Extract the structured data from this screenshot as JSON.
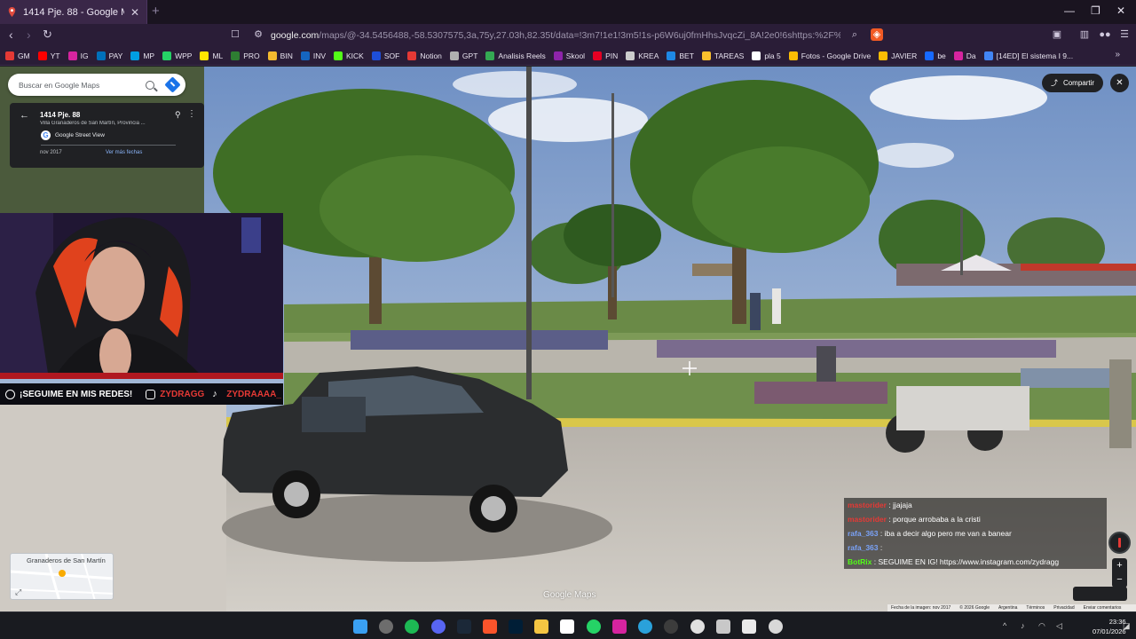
{
  "browser": {
    "tab_title": "1414 Pje. 88 - Google Maps",
    "url_host": "google.com",
    "url_path": "/maps/@-34.5456488,-58.5307575,3a,75y,27.03h,82.35t/data=!3m7!1e1!3m5!1s-p6W6uj0fmHhsJvqcZi_8A!2e0!6shttps:%2F%2Fstreetviewpixels...",
    "bookmarks": [
      {
        "label": "GM",
        "color": "#e53935"
      },
      {
        "label": "YT",
        "color": "#ff0000"
      },
      {
        "label": "IG",
        "color": "#d6249f"
      },
      {
        "label": "PAY",
        "color": "#0070ba"
      },
      {
        "label": "MP",
        "color": "#009ee3"
      },
      {
        "label": "WPP",
        "color": "#25d366"
      },
      {
        "label": "ML",
        "color": "#ffe600"
      },
      {
        "label": "PRO",
        "color": "#2e7d32"
      },
      {
        "label": "BIN",
        "color": "#f3ba2f"
      },
      {
        "label": "INV",
        "color": "#1565c0"
      },
      {
        "label": "KICK",
        "color": "#53fc18"
      },
      {
        "label": "SOF",
        "color": "#1e4ed8"
      },
      {
        "label": "Notion",
        "color": "#e53935"
      },
      {
        "label": "GPT",
        "color": "#b0b0b0"
      },
      {
        "label": "Analisis Reels",
        "color": "#34a853"
      },
      {
        "label": "Skool",
        "color": "#8e24aa"
      },
      {
        "label": "PIN",
        "color": "#e60023"
      },
      {
        "label": "KREA",
        "color": "#cccccc"
      },
      {
        "label": "BET",
        "color": "#1e88e5"
      },
      {
        "label": "TAREAS",
        "color": "#fbc02d"
      },
      {
        "label": "pla 5",
        "color": "#ffffff"
      },
      {
        "label": "Fotos - Google Drive",
        "color": "#fbbc04"
      },
      {
        "label": "JAVIER",
        "color": "#fbbc04"
      },
      {
        "label": "be",
        "color": "#1769ff"
      },
      {
        "label": "Da",
        "color": "#d6249f"
      },
      {
        "label": "[14ED] El sistema I 9...",
        "color": "#4285f4"
      }
    ],
    "bookmarks_more": "»"
  },
  "maps": {
    "search_placeholder": "Buscar en Google Maps",
    "place_title": "1414 Pje. 88",
    "place_subtitle": "Villa Granaderos de San Martín, Provincia ...",
    "source": "Google Street View",
    "capture_date": "nov 2017",
    "more_dates": "Ver más fechas",
    "share_label": "Compartir",
    "minimap_label": "Granaderos de San Martín",
    "watermark": "Google Maps",
    "footer": [
      "Fecha de la imagen: nov 2017",
      "© 2026 Google",
      "Argentina",
      "Términos",
      "Privacidad",
      "Enviar comentarios"
    ]
  },
  "stream": {
    "social_text": "¡SEGUIME EN MIS REDES!",
    "handle_ig": "ZYDRAGG",
    "handle_tiktok": "ZYDRAAAA_"
  },
  "chat": [
    {
      "user": "mastorider",
      "text": ": jjajaja",
      "color": "#e53935"
    },
    {
      "user": "mastorider",
      "text": ": porque arrobaba a la cristi",
      "color": "#e53935"
    },
    {
      "user": "rafa_363",
      "text": ": iba a decir algo pero me van a banear",
      "color": "#7aa2f7"
    },
    {
      "user": "rafa_363",
      "text": ":",
      "color": "#7aa2f7"
    },
    {
      "user": "BotRix",
      "text": ": SEGUIME EN IG! https://www.instagram.com/zydragg",
      "color": "#53fc18"
    }
  ],
  "taskbar": {
    "time": "23:36",
    "date": "07/01/2026"
  }
}
